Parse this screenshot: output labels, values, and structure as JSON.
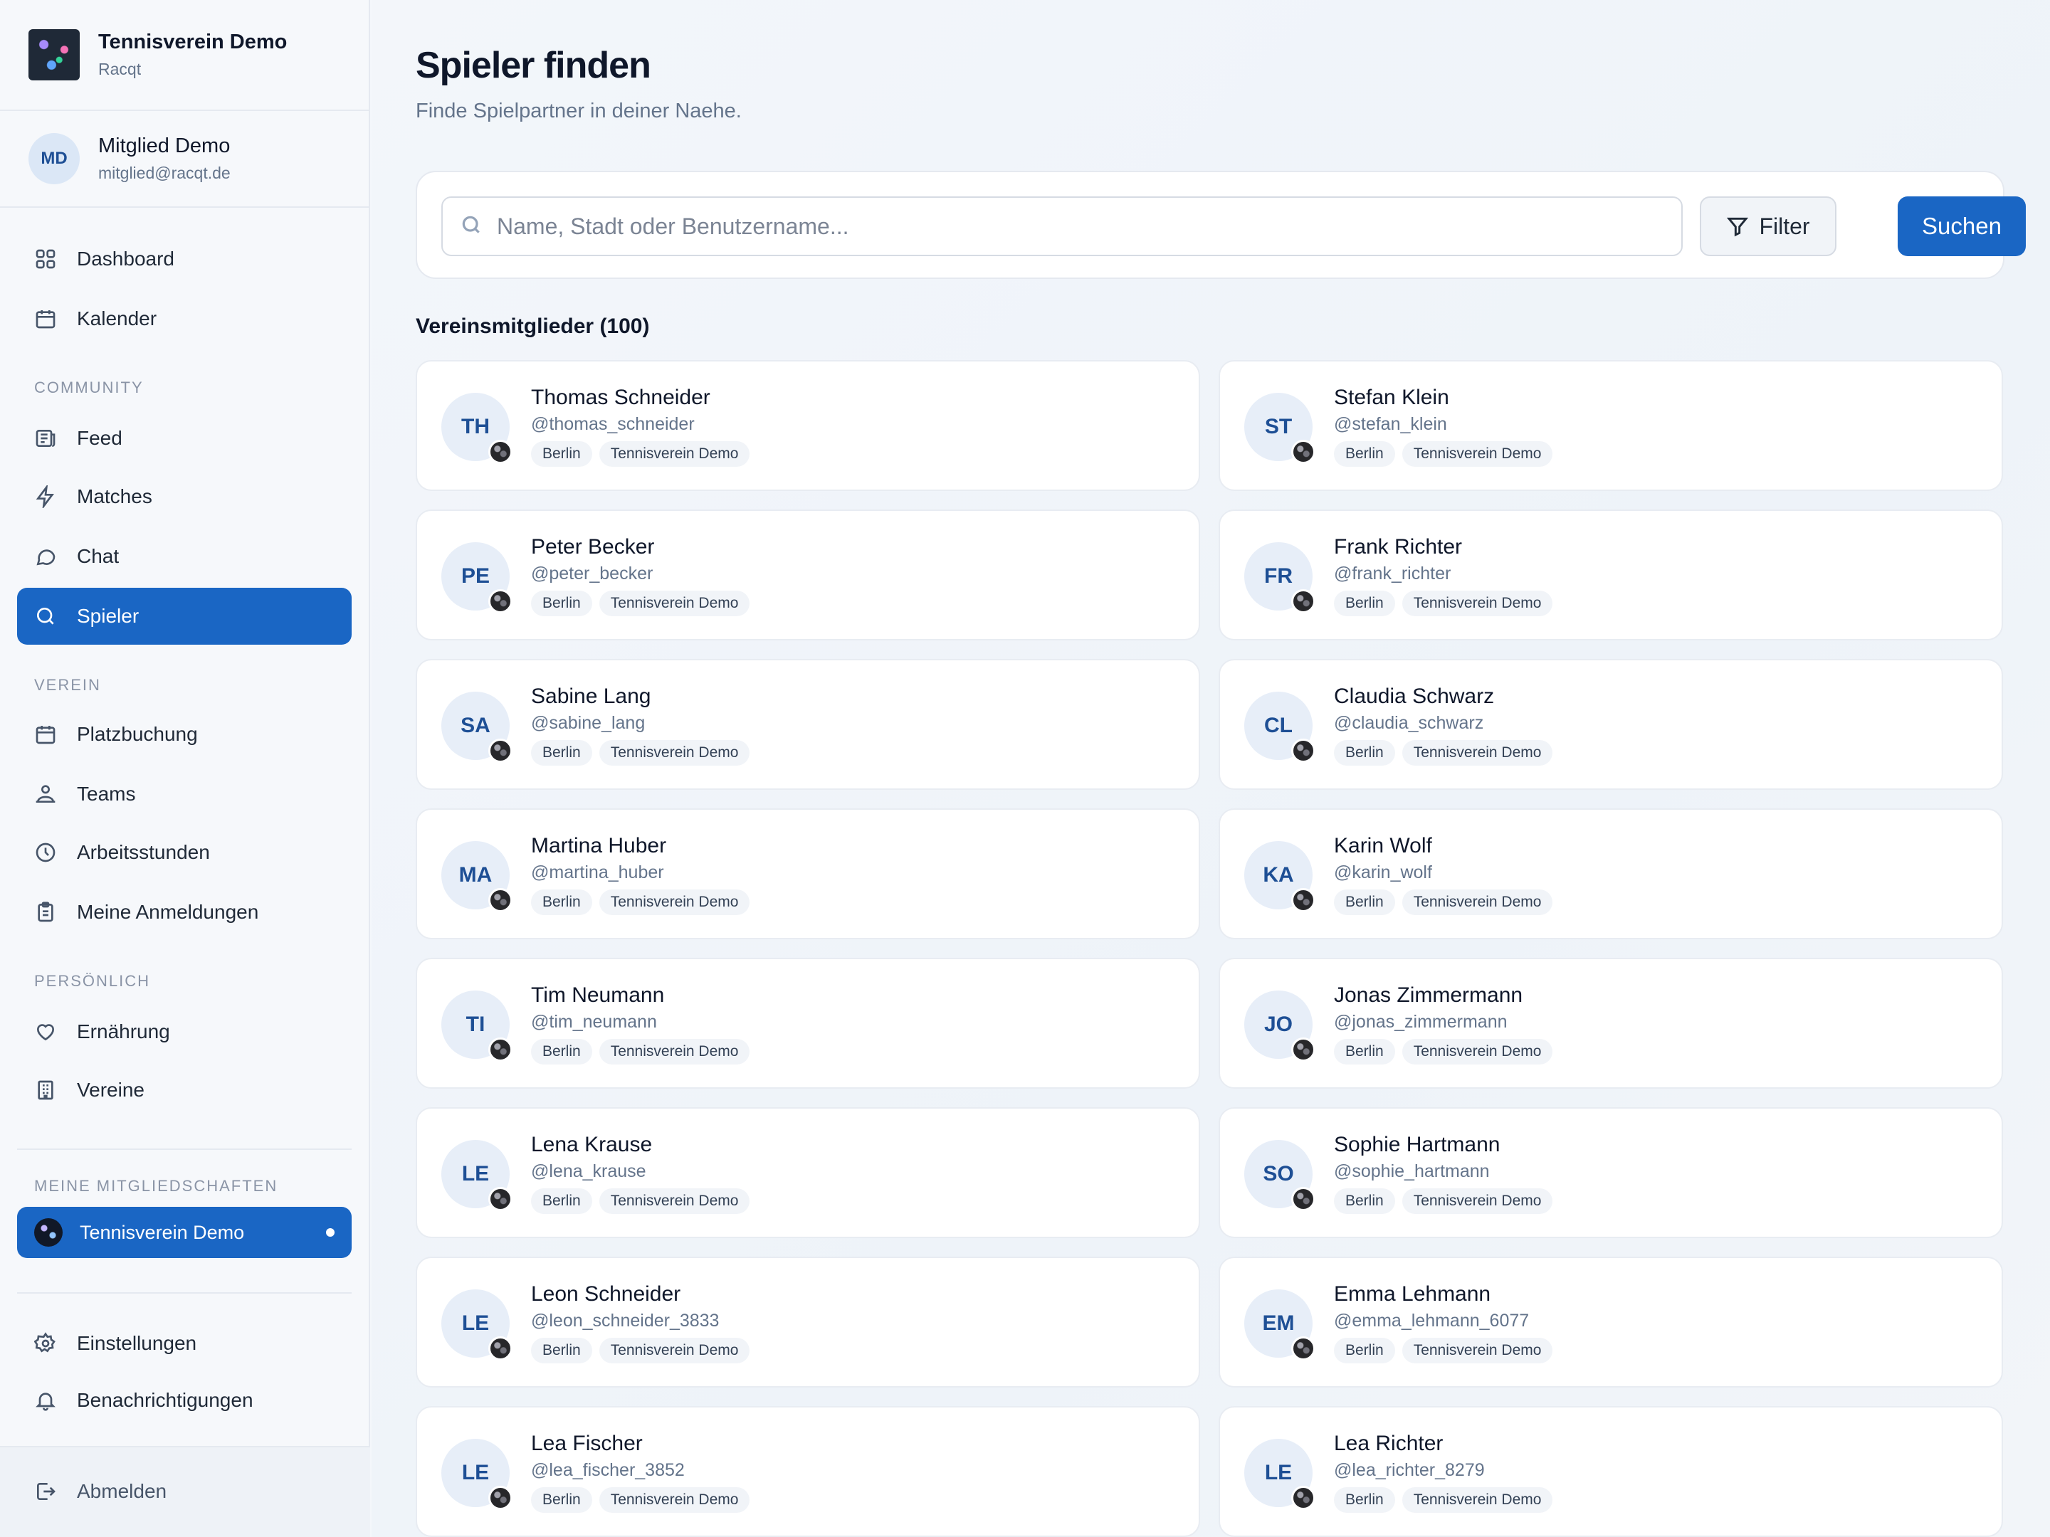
{
  "app": {
    "club_name": "Tennisverein Demo",
    "brand": "Racqt"
  },
  "user": {
    "initials": "MD",
    "name": "Mitglied Demo",
    "email": "mitglied@racqt.de"
  },
  "nav": {
    "dashboard": "Dashboard",
    "kalender": "Kalender",
    "section_community": "COMMUNITY",
    "feed": "Feed",
    "matches": "Matches",
    "chat": "Chat",
    "spieler": "Spieler",
    "section_verein": "VEREIN",
    "platzbuchung": "Platzbuchung",
    "teams": "Teams",
    "arbeitsstunden": "Arbeitsstunden",
    "anmeldungen": "Meine Anmeldungen",
    "section_persoenlich": "PERSÖNLICH",
    "ernaehrung": "Ernährung",
    "vereine": "Vereine",
    "section_mitgliedschaften": "MEINE MITGLIEDSCHAFTEN",
    "membership": "Tennisverein Demo",
    "einstellungen": "Einstellungen",
    "benachrichtigungen": "Benachrichtigungen",
    "abmelden": "Abmelden"
  },
  "page": {
    "title": "Spieler finden",
    "subtitle": "Finde Spielpartner in deiner Naehe.",
    "search_placeholder": "Name, Stadt oder Benutzername...",
    "search_value": "",
    "filter_label": "Filter",
    "search_button": "Suchen",
    "list_title": "Vereinsmitglieder (100)"
  },
  "colors": {
    "accent": "#1a66c4",
    "avatar_bg": "#e7eef8",
    "avatar_text": "#1e4f95"
  },
  "players": [
    {
      "initials": "TH",
      "name": "Thomas Schneider",
      "username": "@thomas_schneider",
      "city": "Berlin",
      "club": "Tennisverein Demo"
    },
    {
      "initials": "ST",
      "name": "Stefan Klein",
      "username": "@stefan_klein",
      "city": "Berlin",
      "club": "Tennisverein Demo"
    },
    {
      "initials": "PE",
      "name": "Peter Becker",
      "username": "@peter_becker",
      "city": "Berlin",
      "club": "Tennisverein Demo"
    },
    {
      "initials": "FR",
      "name": "Frank Richter",
      "username": "@frank_richter",
      "city": "Berlin",
      "club": "Tennisverein Demo"
    },
    {
      "initials": "SA",
      "name": "Sabine Lang",
      "username": "@sabine_lang",
      "city": "Berlin",
      "club": "Tennisverein Demo"
    },
    {
      "initials": "CL",
      "name": "Claudia Schwarz",
      "username": "@claudia_schwarz",
      "city": "Berlin",
      "club": "Tennisverein Demo"
    },
    {
      "initials": "MA",
      "name": "Martina Huber",
      "username": "@martina_huber",
      "city": "Berlin",
      "club": "Tennisverein Demo"
    },
    {
      "initials": "KA",
      "name": "Karin Wolf",
      "username": "@karin_wolf",
      "city": "Berlin",
      "club": "Tennisverein Demo"
    },
    {
      "initials": "TI",
      "name": "Tim Neumann",
      "username": "@tim_neumann",
      "city": "Berlin",
      "club": "Tennisverein Demo"
    },
    {
      "initials": "JO",
      "name": "Jonas Zimmermann",
      "username": "@jonas_zimmermann",
      "city": "Berlin",
      "club": "Tennisverein Demo"
    },
    {
      "initials": "LE",
      "name": "Lena Krause",
      "username": "@lena_krause",
      "city": "Berlin",
      "club": "Tennisverein Demo"
    },
    {
      "initials": "SO",
      "name": "Sophie Hartmann",
      "username": "@sophie_hartmann",
      "city": "Berlin",
      "club": "Tennisverein Demo"
    },
    {
      "initials": "LE",
      "name": "Leon Schneider",
      "username": "@leon_schneider_3833",
      "city": "Berlin",
      "club": "Tennisverein Demo"
    },
    {
      "initials": "EM",
      "name": "Emma Lehmann",
      "username": "@emma_lehmann_6077",
      "city": "Berlin",
      "club": "Tennisverein Demo"
    },
    {
      "initials": "LE",
      "name": "Lea Fischer",
      "username": "@lea_fischer_3852",
      "city": "Berlin",
      "club": "Tennisverein Demo"
    },
    {
      "initials": "LE",
      "name": "Lea Richter",
      "username": "@lea_richter_8279",
      "city": "Berlin",
      "club": "Tennisverein Demo"
    }
  ]
}
